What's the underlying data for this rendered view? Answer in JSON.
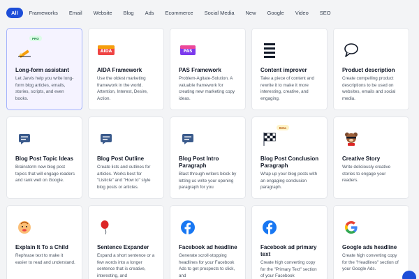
{
  "filters": [
    "All",
    "Frameworks",
    "Email",
    "Website",
    "Blog",
    "Ads",
    "Ecommerce",
    "Social Media",
    "New",
    "Google",
    "Video",
    "SEO"
  ],
  "active_filter": "All",
  "badges": {
    "pro": "PRO",
    "beta": "Beta"
  },
  "icon_text": {
    "aida": "AIDA",
    "pas": "PAS"
  },
  "cards": [
    {
      "title": "Long-form assistant",
      "desc": "Let Jarvis help you write long-form blog articles, emails, stories, scripts, and even books.",
      "icon": "pencil-icon"
    },
    {
      "title": "AIDA Framework",
      "desc": "Use the oldest marketing framework in the world. Attention, Interest, Desire, Action.",
      "icon": "aida-icon"
    },
    {
      "title": "PAS Framework",
      "desc": "Problem-Agitate-Solution. A valuable framework for creating new marketing copy ideas.",
      "icon": "pas-icon"
    },
    {
      "title": "Content improver",
      "desc": "Take a piece of content and rewrite it to make it more interesting, creative, and engaging.",
      "icon": "lines-icon"
    },
    {
      "title": "Product description",
      "desc": "Create compelling product descriptions to be used on websites, emails and social media.",
      "icon": "speech-bubble-icon"
    },
    {
      "title": "Blog Post Topic Ideas",
      "desc": "Brainstorm new blog post topics that will engage readers and rank well on Google.",
      "icon": "chat-icon"
    },
    {
      "title": "Blog Post Outline",
      "desc": "Create lists and outlines for articles. Works best for \"Listicle\" and \"How to\" style blog posts or articles.",
      "icon": "chat-icon"
    },
    {
      "title": "Blog Post Intro Paragraph",
      "desc": "Blast through writers block by letting us write your opening paragraph for you",
      "icon": "chat-icon"
    },
    {
      "title": "Blog Post Conclusion Paragraph",
      "desc": "Wrap up your blog posts with an engaging conclusion paragraph.",
      "icon": "checkered-flag-icon"
    },
    {
      "title": "Creative Story",
      "desc": "Write deliciously creative stories to engage your readers.",
      "icon": "bear-icon"
    },
    {
      "title": "Explain It To a Child",
      "desc": "Rephrase text to make it easier to read and understand.",
      "icon": "baby-icon"
    },
    {
      "title": "Sentence Expander",
      "desc": "Expand a short sentence or a few words into a longer sentence that is creative, interesting, and",
      "icon": "balloon-icon"
    },
    {
      "title": "Facebook ad headline",
      "desc": "Generate scroll-stopping headlines for your Facebook Ads to get prospects to click, and",
      "icon": "facebook-icon"
    },
    {
      "title": "Facebook ad primary text",
      "desc": "Create high converting copy for the \"Primary Text\" section of your Facebook",
      "icon": "facebook-icon"
    },
    {
      "title": "Google ads headline",
      "desc": "Create high converting copy for the \"Headlines\" section of your Google Ads.",
      "icon": "google-icon"
    }
  ]
}
